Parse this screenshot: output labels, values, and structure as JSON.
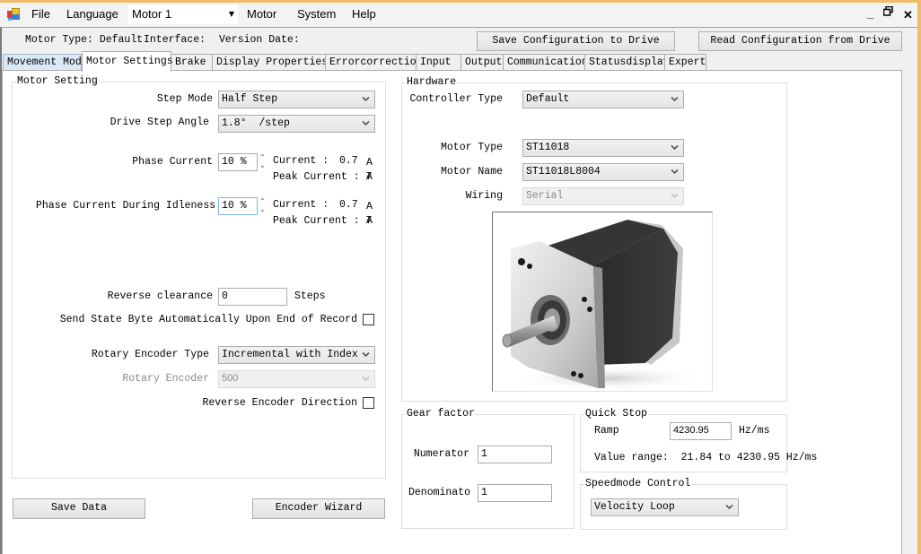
{
  "menubar": {
    "items": [
      "File",
      "Language",
      "Motor",
      "System",
      "Help"
    ],
    "motor_selector": "Motor 1",
    "window_controls": {
      "minimize": "_",
      "restore": "🗗",
      "close": "✕"
    }
  },
  "info_bar": {
    "motor_type": "Motor Type: Default",
    "interface": "Interface:",
    "version_date": "Version Date:",
    "save_config_button": "Save Configuration to Drive",
    "read_config_button": "Read Configuration from Drive"
  },
  "tabs": [
    {
      "label": "Movement Mode"
    },
    {
      "label": "Motor Settings",
      "active": true
    },
    {
      "label": "Brake"
    },
    {
      "label": "Display Properties"
    },
    {
      "label": "Errorcorrection"
    },
    {
      "label": "Input"
    },
    {
      "label": "Output"
    },
    {
      "label": "Communication"
    },
    {
      "label": "Statusdisplay"
    },
    {
      "label": "Expert"
    }
  ],
  "motor_setting": {
    "title": "Motor Setting",
    "step_mode_label": "Step Mode",
    "step_mode_value": "Half Step",
    "drive_step_angle_label": "Drive Step Angle",
    "drive_step_angle_value": "1.8°  /step",
    "phase_current_label": "Phase Current",
    "phase_current_value": "10 %",
    "phase_current_current_label": "Current :",
    "phase_current_current_value": "0.7",
    "phase_current_unit": "A",
    "phase_current_peak_label": "Peak Current : 7",
    "phase_current_peak_unit": "A",
    "idle_current_label": "Phase Current During Idleness",
    "idle_current_value": "10 %",
    "idle_current_current_label": "Current :",
    "idle_current_current_value": "0.7",
    "idle_current_unit": "A",
    "idle_current_peak_label": "Peak Current : 7",
    "idle_current_peak_unit": "A",
    "reverse_clearance_label": "Reverse clearance",
    "reverse_clearance_value": "0",
    "reverse_clearance_unit": "Steps",
    "send_state_byte_label": "Send State Byte Automatically Upon End of Record",
    "send_state_byte_checked": false,
    "rotary_encoder_type_label": "Rotary Encoder Type",
    "rotary_encoder_type_value": "Incremental with Index",
    "rotary_encoder_label": "Rotary Encoder",
    "rotary_encoder_value": "500",
    "reverse_encoder_label": "Reverse Encoder Direction",
    "reverse_encoder_checked": false
  },
  "buttons": {
    "save_data": "Save Data",
    "encoder_wizard": "Encoder Wizard"
  },
  "hardware": {
    "title": "Hardware",
    "controller_type_label": "Controller Type",
    "controller_type_value": "Default",
    "motor_type_label": "Motor Type",
    "motor_type_value": "ST11018",
    "motor_name_label": "Motor Name",
    "motor_name_value": "ST11018L8004",
    "wiring_label": "Wiring",
    "wiring_value": "Serial",
    "image_alt": "stepper-motor-photo"
  },
  "gear_factor": {
    "title": "Gear factor",
    "numerator_label": "Numerator",
    "numerator_value": "1",
    "denominator_label": "Denominato",
    "denominator_value": "1"
  },
  "quick_stop": {
    "title": "Quick Stop",
    "ramp_label": "Ramp",
    "ramp_value": "4230.95",
    "ramp_unit": "Hz/ms",
    "value_range": "Value range:  21.84 to 4230.95 Hz/ms"
  },
  "speedmode": {
    "title": "Speedmode Control",
    "value": "Velocity Loop"
  }
}
